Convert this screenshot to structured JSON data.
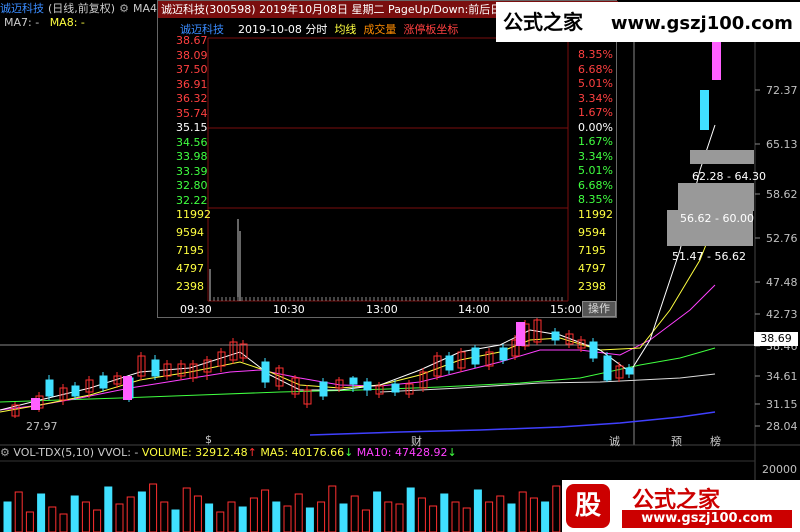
{
  "header": {
    "stock_name": "诚迈科技",
    "chart_mode": "(日线,前复权)",
    "ma_label": "MA4",
    "ma7": "MA7: -",
    "ma8": "MA8: -"
  },
  "popup": {
    "title": "诚迈科技(300598)  2019年10月08日 星期二 PageUp/Down:前后日 空",
    "subtitle_name": "诚迈科技",
    "subtitle_date": "2019-10-08 分时",
    "legend_avg": "均线",
    "legend_vol": "成交量",
    "legend_limit": "涨停板坐标",
    "price_ticks": [
      "38.67",
      "38.09",
      "37.50",
      "36.91",
      "36.32",
      "35.74",
      "35.15",
      "34.56",
      "33.98",
      "33.39",
      "32.80",
      "32.22"
    ],
    "pct_ticks": [
      "8.35%",
      "6.68%",
      "5.01%",
      "3.34%",
      "1.67%",
      "0.00%",
      "1.67%",
      "3.34%",
      "5.01%",
      "6.68%",
      "8.35%"
    ],
    "vol_ticks_left": [
      "11992",
      "9594",
      "7195",
      "4797",
      "2398"
    ],
    "vol_ticks_right": [
      "11992",
      "9594",
      "7195",
      "4797",
      "2398"
    ],
    "time_labels": [
      "09:30",
      "10:30",
      "13:00",
      "14:00",
      "15:00"
    ],
    "op_button": "操作"
  },
  "main_chart": {
    "right_axis": [
      "72.37",
      "65.13",
      "58.62",
      "52.76",
      "47.48",
      "42.73",
      "38.46",
      "34.61",
      "31.15",
      "28.04"
    ],
    "current_price_tag": "38.69",
    "low_label": "27.97",
    "range_labels": [
      "62.28 - 64.30",
      "56.62 - 60.00",
      "51.47 - 56.62"
    ],
    "markers": [
      {
        "text": "$",
        "color": "#ff3030"
      },
      {
        "text": "财",
        "color": "#3a8cff"
      },
      {
        "text": "诚",
        "color": "#40ff40"
      },
      {
        "text": "预",
        "color": "#ff8c00"
      },
      {
        "text": "榜",
        "color": "#ff8c00"
      }
    ]
  },
  "volume_panel": {
    "indicator": "VOL-TDX(5,10)",
    "vvol": "VVOL: -",
    "volume": "VOLUME: 32912.48",
    "ma5": "MA5: 40176.66",
    "ma10": "MA10: 47428.92",
    "right_axis_top": "20000"
  },
  "watermarks": {
    "top_cn": "公式之家",
    "top_url": "www.gszj100.com",
    "bottom_cn": "公式之家",
    "bottom_url": "www.gszj100.com",
    "bottom_badge": "股"
  },
  "colors": {
    "up": "#ff3030",
    "down": "#40e0ff",
    "ma5": "#ffffff",
    "ma10": "#ffff40",
    "ma20": "#ff40ff",
    "ma60": "#40ff40",
    "ma120": "#4040ff"
  }
}
